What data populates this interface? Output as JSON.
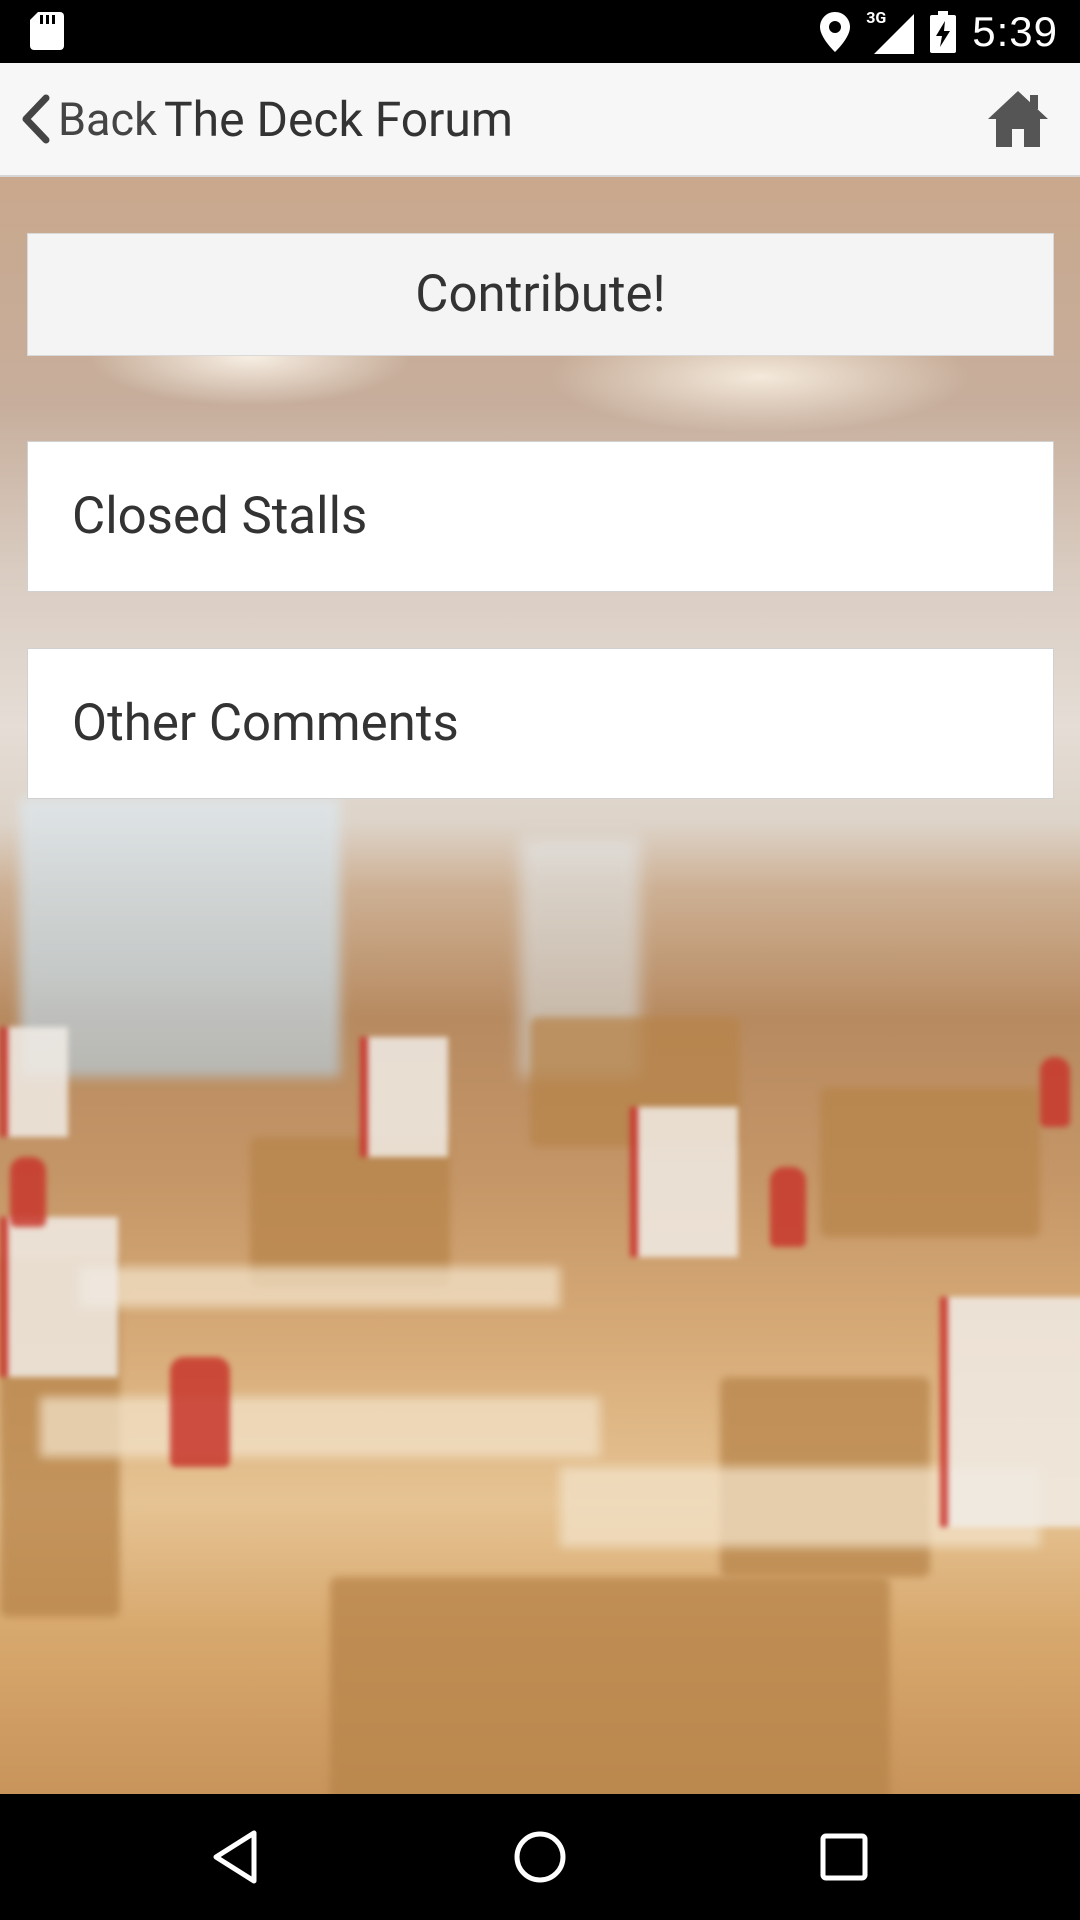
{
  "status_bar": {
    "network": "3G",
    "time": "5:39",
    "icons": [
      "sd-card-icon",
      "location-icon",
      "signal-icon",
      "battery-charging-icon"
    ]
  },
  "app_bar": {
    "back_label": "Back",
    "title": "The Deck Forum",
    "home_icon": "home-icon"
  },
  "main": {
    "contribute_label": "Contribute!",
    "forum_items": [
      {
        "label": "Closed Stalls"
      },
      {
        "label": "Other Comments"
      }
    ]
  },
  "nav_bar": {
    "icons": [
      "back-triangle-icon",
      "home-circle-icon",
      "recents-square-icon"
    ]
  },
  "colors": {
    "app_bar_bg": "#f7f7f7",
    "item_bg": "#ffffff",
    "contribute_bg": "#f4f4f4",
    "text": "#333333"
  }
}
